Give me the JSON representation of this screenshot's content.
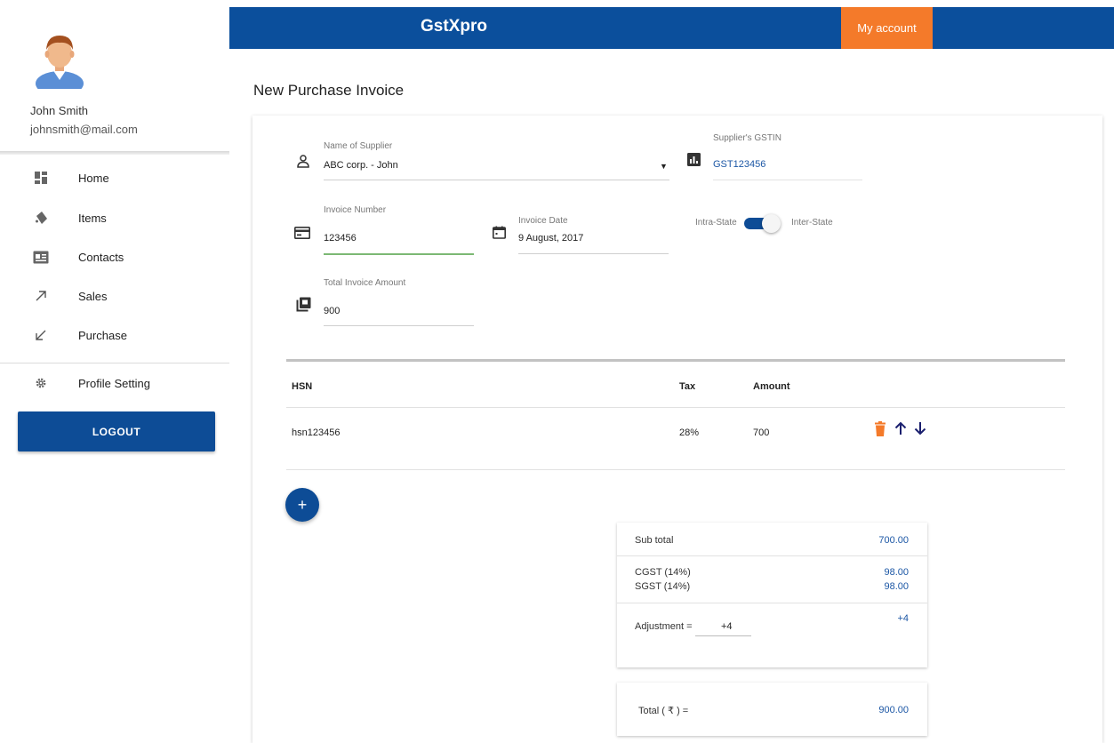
{
  "app": {
    "brand": "GstXpro",
    "account_button": "My account"
  },
  "user": {
    "name": "John Smith",
    "email": "johnsmith@mail.com"
  },
  "sidebar": {
    "items": [
      {
        "label": "Home",
        "icon": "dashboard-icon"
      },
      {
        "label": "Items",
        "icon": "tag-icon"
      },
      {
        "label": "Contacts",
        "icon": "contact-card-icon"
      },
      {
        "label": "Sales",
        "icon": "arrow-up-right-icon"
      },
      {
        "label": "Purchase",
        "icon": "arrow-down-left-icon"
      },
      {
        "label": "Profile Setting",
        "icon": "gear-icon"
      }
    ],
    "logout": "LOGOUT"
  },
  "page": {
    "title": "New Purchase Invoice"
  },
  "form": {
    "supplier": {
      "label": "Name of Supplier",
      "value": "ABC corp. - John"
    },
    "gstin": {
      "label": "Supplier's GSTIN",
      "value": "GST123456"
    },
    "invoice_number": {
      "label": "Invoice Number",
      "value": "123456"
    },
    "invoice_date": {
      "label": "Invoice Date",
      "value": "9 August, 2017"
    },
    "toggle": {
      "left_label": "Intra-State",
      "right_label": "Inter-State",
      "state": "Inter-State"
    },
    "total_amount": {
      "label": "Total Invoice Amount",
      "value": "900"
    }
  },
  "table": {
    "headers": {
      "hsn": "HSN",
      "tax": "Tax",
      "amount": "Amount"
    },
    "rows": [
      {
        "hsn": "hsn123456",
        "tax": "28%",
        "amount": "700"
      }
    ]
  },
  "summary": {
    "subtotal_label": "Sub total",
    "subtotal_value": "700.00",
    "cgst_label": "CGST (14%)",
    "cgst_value": "98.00",
    "sgst_label": "SGST (14%)",
    "sgst_value": "98.00",
    "adjustment_label": "Adjustment =",
    "adjustment_input": "+4",
    "adjustment_value": "+4",
    "total_label": "Total ( ₹ ) =",
    "total_value": "900.00"
  },
  "colors": {
    "primary": "#0b4f9c",
    "accent": "#f47a2a",
    "link": "#1c57a5",
    "delete": "#f47a2a"
  }
}
